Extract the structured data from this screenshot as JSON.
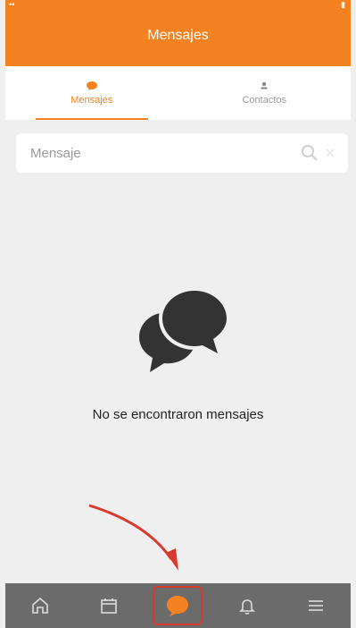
{
  "appbar": {
    "title": "Mensajes"
  },
  "tabs": [
    {
      "label": "Mensajes",
      "icon": "chat-bubble-icon",
      "active": true
    },
    {
      "label": "Contactos",
      "icon": "person-icon",
      "active": false
    }
  ],
  "search": {
    "placeholder": "Mensaje"
  },
  "empty_state": {
    "message": "No se encontraron mensajes",
    "icon": "chat-bubbles-icon"
  },
  "bottom_nav": [
    {
      "name": "home",
      "icon": "home-icon"
    },
    {
      "name": "calendar",
      "icon": "calendar-icon"
    },
    {
      "name": "messages",
      "icon": "chat-bubble-icon",
      "active": true
    },
    {
      "name": "notifications",
      "icon": "bell-icon"
    },
    {
      "name": "menu",
      "icon": "hamburger-menu-icon"
    }
  ],
  "colors": {
    "brand": "#f58220",
    "nav_bg": "#6b6b6b",
    "annotation": "#d93a2e"
  }
}
